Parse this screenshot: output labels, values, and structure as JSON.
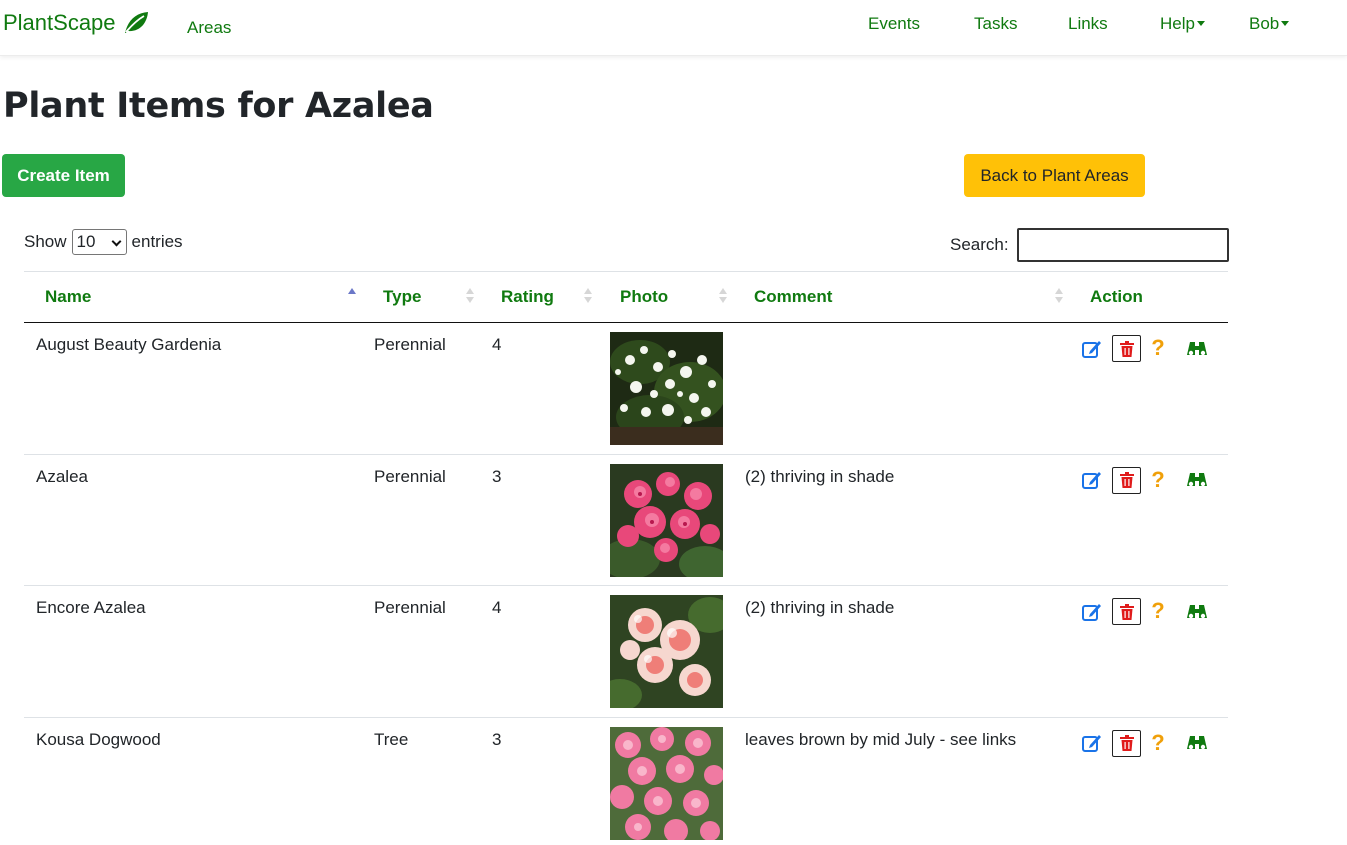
{
  "nav": {
    "brand": "PlantScape",
    "areas": "Areas",
    "events": "Events",
    "tasks": "Tasks",
    "links": "Links",
    "help": "Help",
    "user": "Bob"
  },
  "page": {
    "title": "Plant Items for Azalea",
    "create_label": "Create Item",
    "back_label": "Back to Plant Areas"
  },
  "table_controls": {
    "show_label": "Show",
    "entries_value": "10",
    "entries_label": "entries",
    "search_label": "Search:"
  },
  "columns": [
    "Name",
    "Type",
    "Rating",
    "Photo",
    "Comment",
    "Action"
  ],
  "rows": [
    {
      "name": "August Beauty Gardenia",
      "type": "Perennial",
      "rating": "4",
      "comment": ""
    },
    {
      "name": "Azalea",
      "type": "Perennial",
      "rating": "3",
      "comment": "(2) thriving in shade"
    },
    {
      "name": "Encore Azalea",
      "type": "Perennial",
      "rating": "4",
      "comment": "(2) thriving in shade"
    },
    {
      "name": "Kousa Dogwood",
      "type": "Tree",
      "rating": "3",
      "comment": "leaves brown by mid July - see links"
    }
  ],
  "colors": {
    "brand_green": "#107a10",
    "create_button": "#28a745",
    "back_button": "#ffc107",
    "edit_icon": "#1a73e8",
    "delete_icon": "#e01b1b",
    "help_icon": "#f0a00a",
    "view_icon": "#107a10"
  },
  "icons": {
    "brand": "leaf-icon",
    "edit": "edit-icon",
    "delete": "trash-icon",
    "help": "question-icon",
    "view": "binoculars-icon"
  }
}
